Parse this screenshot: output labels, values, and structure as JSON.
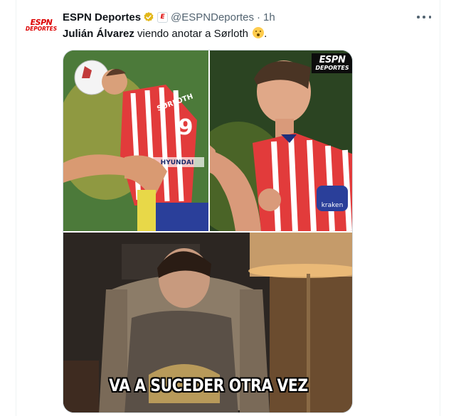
{
  "account": {
    "avatar_top": "ESPN",
    "avatar_bottom": "DEPORTES",
    "name": "ESPN Deportes",
    "affiliate_badge": "E",
    "handle": "@ESPNDeportes",
    "separator": "·",
    "time": "1h"
  },
  "tweet": {
    "mention": "Julián Álvarez",
    "text": " viendo anotar a Sørloth "
  },
  "media": {
    "watermark_top": "ESPN",
    "watermark_bottom": "DEPORTES",
    "jersey_name": "SØRLOTH",
    "jersey_number": "9",
    "sponsor": "HYUNDAI",
    "sleeve_sponsor": "kraken",
    "caption": "VA A SUCEDER OTRA VEZ"
  },
  "colors": {
    "verified_gold": "#e2b719",
    "brand_red": "#dd0000",
    "text_primary": "#0f1419",
    "text_secondary": "#536471",
    "border": "#cfd9de"
  },
  "icons": {
    "verified": "verified-badge-icon",
    "more": "more-options-icon",
    "emoji": "flushed-face-emoji"
  }
}
